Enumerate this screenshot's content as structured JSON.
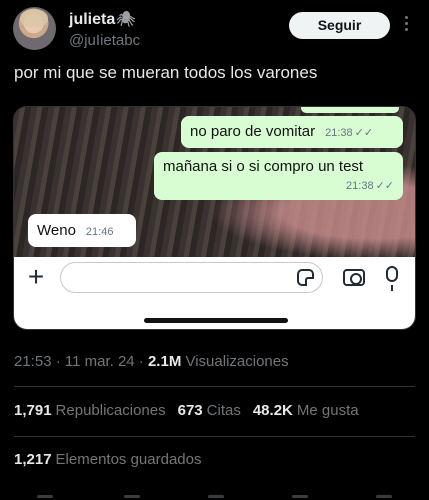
{
  "author": {
    "display_name": "julieta",
    "name_emoji": "🕷",
    "handle": "@juIietabc"
  },
  "follow_label": "Seguir",
  "tweet_text": "por mi que se mueran todos los varones",
  "chat": {
    "messages": [
      {
        "text": "no paro de vomitar",
        "time": "21:38",
        "ticks": "✓✓",
        "direction": "out"
      },
      {
        "text": "mañana si o si compro un test",
        "time": "21:38",
        "ticks": "✓✓",
        "direction": "out"
      },
      {
        "text": "Weno",
        "time": "21:46",
        "direction": "in"
      }
    ]
  },
  "meta": {
    "time_date": "21:53 · 11 mar. 24 · ",
    "views_count": "2.1M",
    "views_label": " Visualizaciones"
  },
  "stats": {
    "reposts_count": "1,791",
    "reposts_label": "Republicaciones",
    "quotes_count": "673",
    "quotes_label": "Citas",
    "likes_count": "48.2K",
    "likes_label": "Me gusta",
    "bookmarks_count": "1,217",
    "bookmarks_label": "Elementos guardados"
  },
  "colors": {
    "background": "#000000",
    "outgoing_bubble": "#d9fdd3",
    "incoming_bubble": "#ffffff",
    "muted_text": "#71767b"
  }
}
